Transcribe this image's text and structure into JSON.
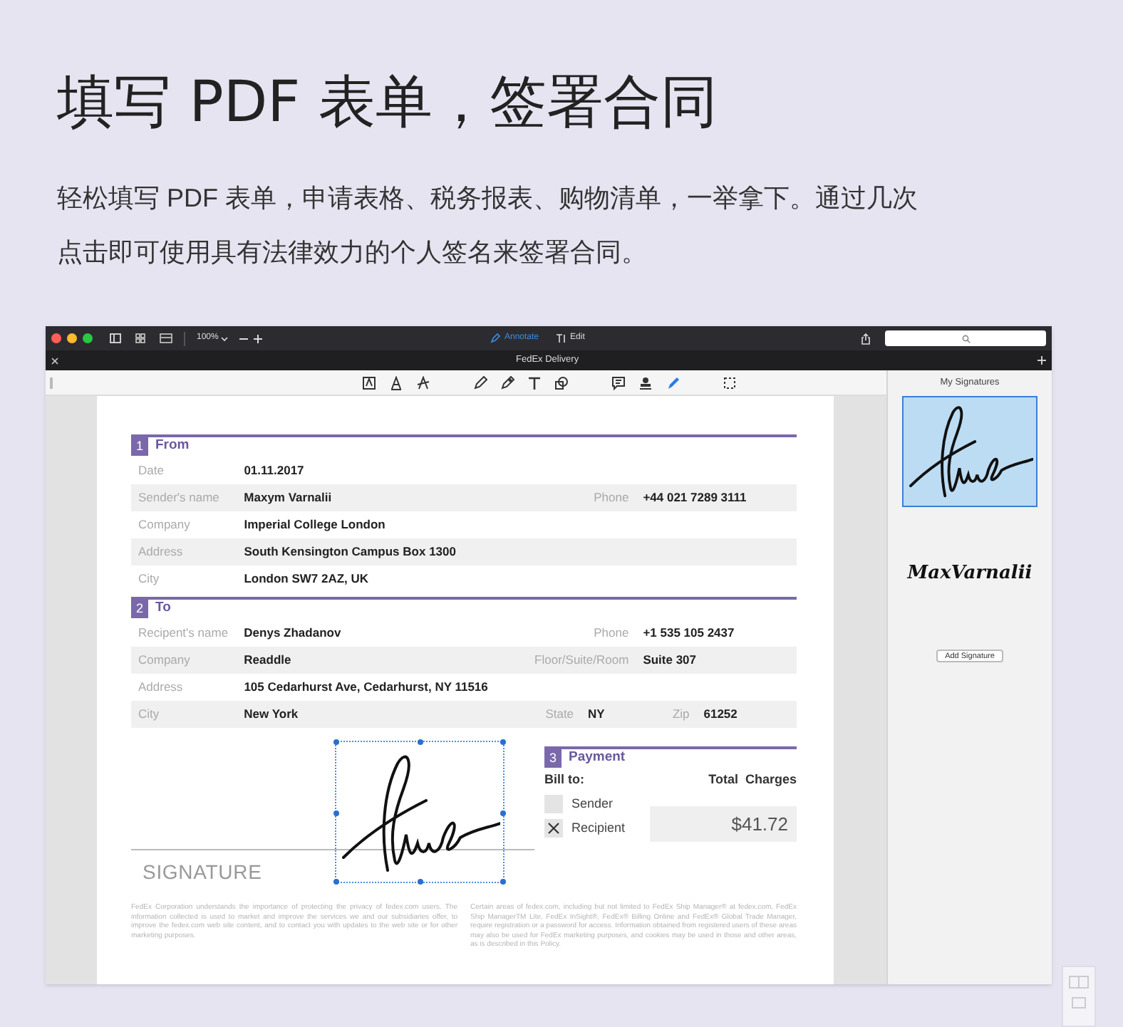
{
  "heading": "填写 PDF 表单，签署合同",
  "intro": "轻松填写 PDF 表单，申请表格、税务报表、购物清单，一举拿下。通过几次点击即可使用具有法律效力的个人签名来签署合同。",
  "app": {
    "zoom": "100%",
    "modes": [
      {
        "label": "Annotate",
        "selected": true
      },
      {
        "label": "Edit",
        "selected": false
      }
    ],
    "tab_title": "FedEx Delivery",
    "tools": [
      {
        "kind": "text-style",
        "selected": false
      },
      {
        "kind": "text-a",
        "selected": false
      },
      {
        "kind": "strike",
        "selected": false
      },
      {
        "kind": "pencil",
        "selected": false
      },
      {
        "kind": "eraser",
        "selected": false
      },
      {
        "kind": "text",
        "selected": false
      },
      {
        "kind": "shapes",
        "selected": false
      },
      {
        "kind": "comment",
        "selected": false
      },
      {
        "kind": "stamp",
        "selected": false
      },
      {
        "kind": "signature",
        "selected": true
      },
      {
        "kind": "select",
        "selected": false
      }
    ],
    "sidebar": {
      "title": "My Signatures",
      "signatures": [
        {
          "kind": "drawn",
          "selected": true
        },
        {
          "kind": "typed",
          "text": "MaxVarnalii",
          "selected": false
        }
      ],
      "button": "Add Signature"
    }
  },
  "form": {
    "sections": [
      {
        "number": "1",
        "title": "From",
        "rows": [
          {
            "shaded": false,
            "fields": [
              {
                "label": "Date",
                "value": "01.11.2017"
              }
            ]
          },
          {
            "shaded": true,
            "fields": [
              {
                "label": "Sender's name",
                "value": "Maxym Varnalii"
              },
              {
                "label": "Phone",
                "value": "+44 021 7289 3111"
              }
            ]
          },
          {
            "shaded": false,
            "fields": [
              {
                "label": "Company",
                "value": "Imperial College London"
              }
            ]
          },
          {
            "shaded": true,
            "fields": [
              {
                "label": "Address",
                "value": "South Kensington Campus Box 1300"
              }
            ]
          },
          {
            "shaded": false,
            "fields": [
              {
                "label": "City",
                "value": "London SW7 2AZ, UK"
              }
            ]
          }
        ]
      },
      {
        "number": "2",
        "title": "To",
        "rows": [
          {
            "shaded": false,
            "fields": [
              {
                "label": "Recipent's name",
                "value": "Denys Zhadanov"
              },
              {
                "label": "Phone",
                "value": "+1 535 105 2437"
              }
            ]
          },
          {
            "shaded": true,
            "fields": [
              {
                "label": "Company",
                "value": "Readdle"
              },
              {
                "label": "Floor/Suite/Room",
                "value": "Suite 307"
              }
            ]
          },
          {
            "shaded": false,
            "fields": [
              {
                "label": "Address",
                "value": "105 Cedarhurst Ave, Cedarhurst, NY 11516"
              }
            ]
          },
          {
            "shaded": true,
            "fields": [
              {
                "label": "City",
                "value": "New York"
              },
              {
                "label": "State",
                "value": "NY"
              },
              {
                "label": "Zip",
                "value": "61252"
              }
            ]
          }
        ]
      }
    ],
    "signature_label": "SIGNATURE",
    "payment": {
      "number": "3",
      "title": "Payment",
      "bill_to": "Bill to:",
      "total_label": "Total  Charges",
      "options": [
        {
          "label": "Sender",
          "checked": false
        },
        {
          "label": "Recipient",
          "checked": true
        }
      ],
      "total": "$41.72"
    },
    "disclaimer": [
      "FedEx Corporation understands the importance of protecting the privacy of fedex.com users. The information collected is used to market and improve the services we and our subsidiaries offer, to improve the fedex.com web site content, and to contact you with updates to the web site or for other marketing purposes.",
      "Certain areas of fedex.com, including but not limited to FedEx Ship Manager® at fedex.com, FedEx Ship ManagerTM Lite, FedEx InSight®, FedEx® Billing Online and FedEx® Global Trade Manager, require registration or a password for access. Information obtained from registered users of these areas may also be used for FedEx marketing purposes, and cookies may be used in those and other areas, as is described in this Policy."
    ]
  }
}
